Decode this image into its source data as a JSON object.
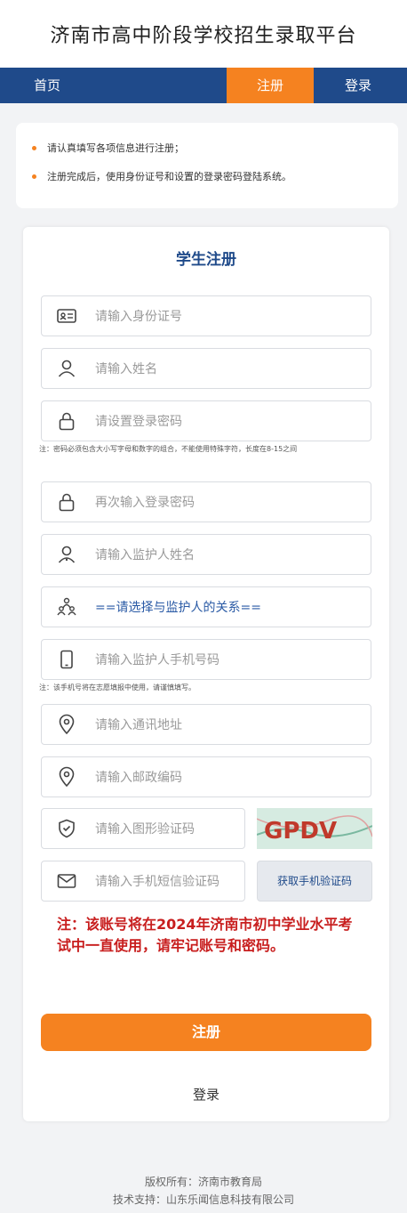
{
  "header": {
    "title": "济南市高中阶段学校招生录取平台"
  },
  "nav": {
    "home": "首页",
    "register": "注册",
    "login": "登录"
  },
  "notice": {
    "items": [
      "请认真填写各项信息进行注册；",
      "注册完成后，使用身份证号和设置的登录密码登陆系统。"
    ]
  },
  "form": {
    "title": "学生注册",
    "id_placeholder": "请输入身份证号",
    "name_placeholder": "请输入姓名",
    "password_placeholder": "请设置登录密码",
    "password_hint": "注：密码必须包含大小写字母和数字的组合，不能使用特殊字符，长度在8-15之间",
    "password_confirm_placeholder": "再次输入登录密码",
    "guardian_name_placeholder": "请输入监护人姓名",
    "relation_select": "==请选择与监护人的关系==",
    "guardian_phone_placeholder": "请输入监护人手机号码",
    "phone_hint": "注：该手机号将在志愿填报中使用，请谨慎填写。",
    "address_placeholder": "请输入通讯地址",
    "postal_placeholder": "请输入邮政编码",
    "captcha_placeholder": "请输入图形验证码",
    "captcha_text": "GPDV",
    "sms_placeholder": "请输入手机短信验证码",
    "sms_button": "获取手机验证码",
    "warning": "注：该账号将在2024年济南市初中学业水平考试中一直使用，请牢记账号和密码。",
    "register_button": "注册",
    "login_link": "登录"
  },
  "footer": {
    "copyright": "版权所有：济南市教育局",
    "support": "技术支持：山东乐闻信息科技有限公司"
  },
  "colors": {
    "brand": "#1f4a8a",
    "accent": "#f58220",
    "warning": "#c81e1e"
  }
}
